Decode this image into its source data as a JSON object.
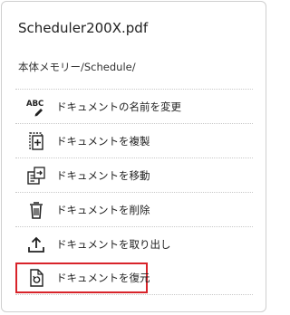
{
  "file": {
    "name": "Scheduler200X.pdf",
    "path": "本体メモリー/Schedule/"
  },
  "menu": {
    "items": [
      {
        "label": "ドキュメントの名前を変更",
        "icon": "rename-abc-icon"
      },
      {
        "label": "ドキュメントを複製",
        "icon": "duplicate-document-icon"
      },
      {
        "label": "ドキュメントを移動",
        "icon": "move-document-icon"
      },
      {
        "label": "ドキュメントを削除",
        "icon": "trash-icon"
      },
      {
        "label": "ドキュメントを取り出し",
        "icon": "export-upload-icon"
      },
      {
        "label": "ドキュメントを復元",
        "icon": "restore-document-icon"
      }
    ]
  },
  "colors": {
    "highlight_border": "#d8232a",
    "divider": "#c8c8c8",
    "text": "#222222"
  }
}
